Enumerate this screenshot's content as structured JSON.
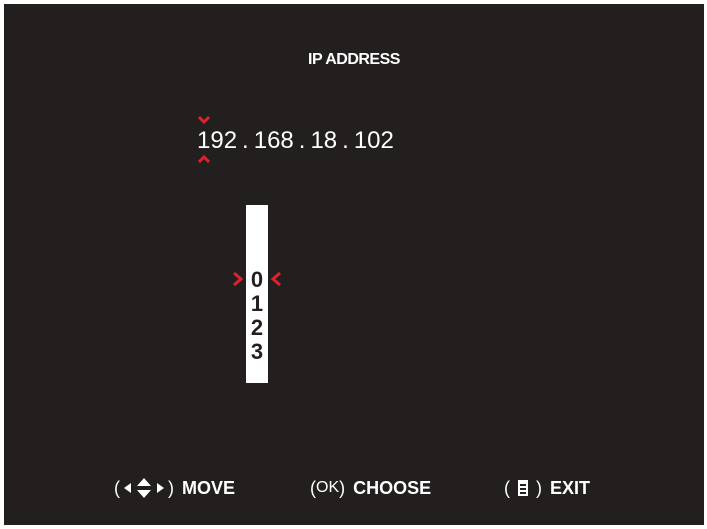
{
  "screen": {
    "title": "IP ADDRESS"
  },
  "ip": {
    "segments": [
      "192",
      "168",
      "18",
      "102"
    ],
    "separator": "."
  },
  "picker": {
    "digits": [
      "0",
      "1",
      "2",
      "3"
    ],
    "selected": "0"
  },
  "footer": {
    "move": {
      "open": "(",
      "close": ")",
      "label": "MOVE",
      "icons": [
        "left-arrow-icon",
        "up-down-arrow-icon",
        "right-arrow-icon"
      ]
    },
    "choose": {
      "open": "(",
      "key": "OK",
      "close": ")",
      "label": "CHOOSE"
    },
    "exit": {
      "open": "(",
      "close": ")",
      "label": "EXIT",
      "icons": [
        "menu-icon"
      ]
    }
  },
  "colors": {
    "background": "#221f1e",
    "text": "#ffffff",
    "accent": "#e0202a"
  }
}
